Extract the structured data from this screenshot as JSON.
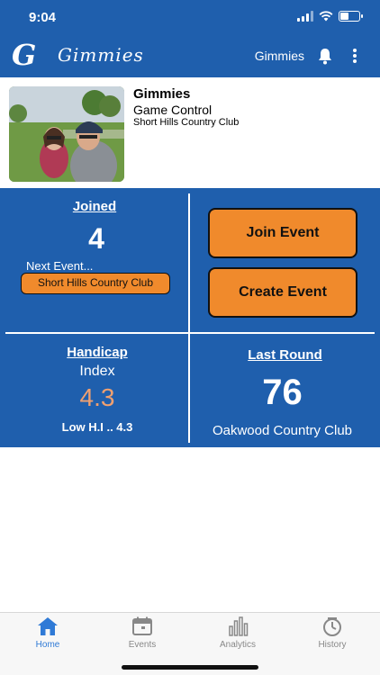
{
  "status_bar": {
    "time": "9:04"
  },
  "header": {
    "logo_letter": "G",
    "title": "Gimmies",
    "right_label": "Gimmies",
    "icons": [
      "bell-icon",
      "more-vertical-icon"
    ]
  },
  "profile": {
    "name": "Gimmies",
    "subtitle": "Game Control",
    "club": "Short Hills Country Club"
  },
  "joined": {
    "title": "Joined",
    "count": "4",
    "next_event_label": "Next Event...",
    "next_event_name": "Short Hills Country Club"
  },
  "actions": {
    "join_label": "Join Event",
    "create_label": "Create Event"
  },
  "handicap": {
    "title": "Handicap",
    "subtitle": "Index",
    "value": "4.3",
    "low_label": "Low H.I .. 4.3"
  },
  "last_round": {
    "title": "Last Round",
    "score": "76",
    "club": "Oakwood Country Club"
  },
  "tabs": [
    {
      "label": "Home",
      "icon": "home-icon",
      "active": true
    },
    {
      "label": "Events",
      "icon": "calendar-icon",
      "active": false
    },
    {
      "label": "Analytics",
      "icon": "bar-chart-icon",
      "active": false
    },
    {
      "label": "History",
      "icon": "stopwatch-icon",
      "active": false
    }
  ],
  "colors": {
    "brand_blue": "#1f5fad",
    "accent_orange": "#f08a2c",
    "handicap_value": "#f0a070",
    "active_tab": "#2f7ad6"
  }
}
